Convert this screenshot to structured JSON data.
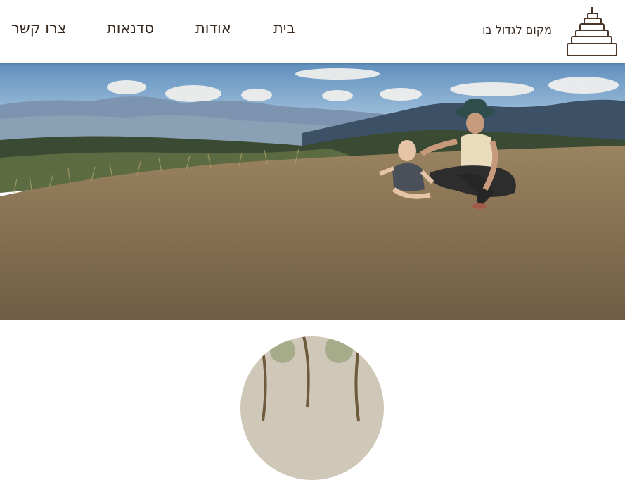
{
  "brand": {
    "name": "מקום לגדול בו",
    "logo_icon": "stacking-rings-toy-icon"
  },
  "nav": {
    "items": [
      {
        "label": "בית"
      },
      {
        "label": "אודות"
      },
      {
        "label": "סדנאות"
      },
      {
        "label": "צרו קשר"
      }
    ]
  },
  "colors": {
    "text": "#3a2a20",
    "sky_top": "#5f8fbd",
    "ground": "#8c7555"
  }
}
